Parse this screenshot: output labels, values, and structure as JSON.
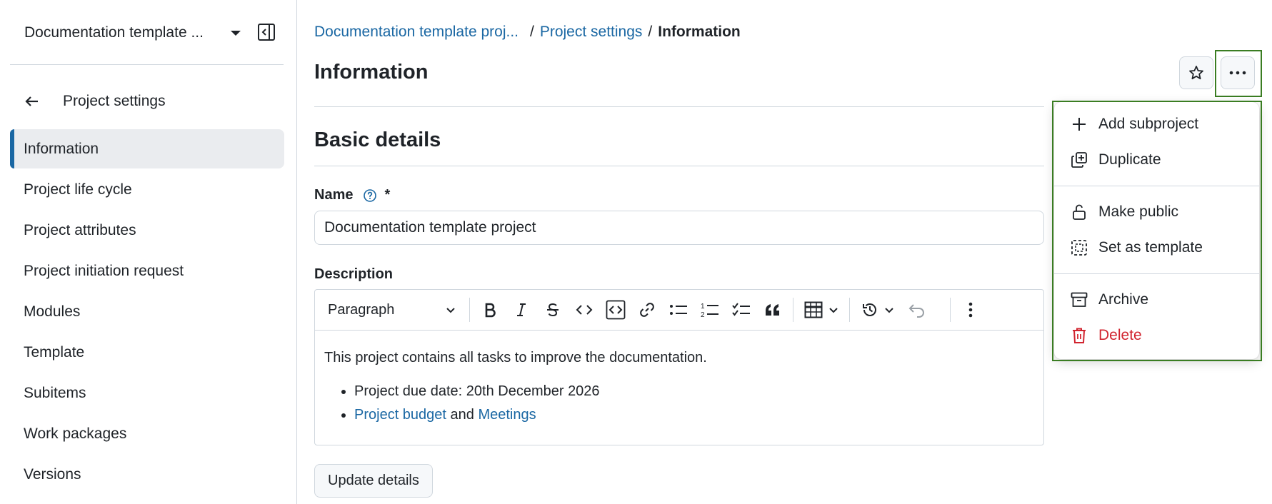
{
  "sidebar": {
    "project_name": "Documentation template ...",
    "back_label": "Project settings",
    "items": [
      {
        "label": "Information"
      },
      {
        "label": "Project life cycle"
      },
      {
        "label": "Project attributes"
      },
      {
        "label": "Project initiation request"
      },
      {
        "label": "Modules"
      },
      {
        "label": "Template"
      },
      {
        "label": "Subitems"
      },
      {
        "label": "Work packages"
      },
      {
        "label": "Versions"
      }
    ],
    "active_item": "Information"
  },
  "breadcrumb": {
    "project": "Documentation template proj...",
    "sep": "/",
    "settings": "Project settings",
    "current": "Information"
  },
  "header": {
    "title": "Information",
    "favorite_icon": "star-icon",
    "more_icon": "more-horizontal-icon"
  },
  "form": {
    "section_title": "Basic details",
    "name_label": "Name",
    "required_mark": "*",
    "name_value": "Documentation template project",
    "description_label": "Description",
    "toolbar": {
      "paragraph": "Paragraph"
    },
    "description": {
      "text": "This project contains all tasks to improve the documentation.",
      "bullet1": "Project due date: 20th December 2026",
      "link1": "Project budget",
      "and": " and ",
      "link2": "Meetings"
    },
    "update_button": "Update details"
  },
  "dropdown": {
    "items": [
      {
        "label": "Add subproject",
        "icon": "plus-icon"
      },
      {
        "label": "Duplicate",
        "icon": "duplicate-icon"
      },
      {
        "label": "Make public",
        "icon": "unlock-icon"
      },
      {
        "label": "Set as template",
        "icon": "template-icon"
      },
      {
        "label": "Archive",
        "icon": "archive-icon"
      },
      {
        "label": "Delete",
        "icon": "trash-icon"
      }
    ]
  },
  "colors": {
    "link": "#1a67a3",
    "danger": "#d1242f",
    "highlight": "#3a7d22",
    "active_bg": "#eaecef"
  }
}
